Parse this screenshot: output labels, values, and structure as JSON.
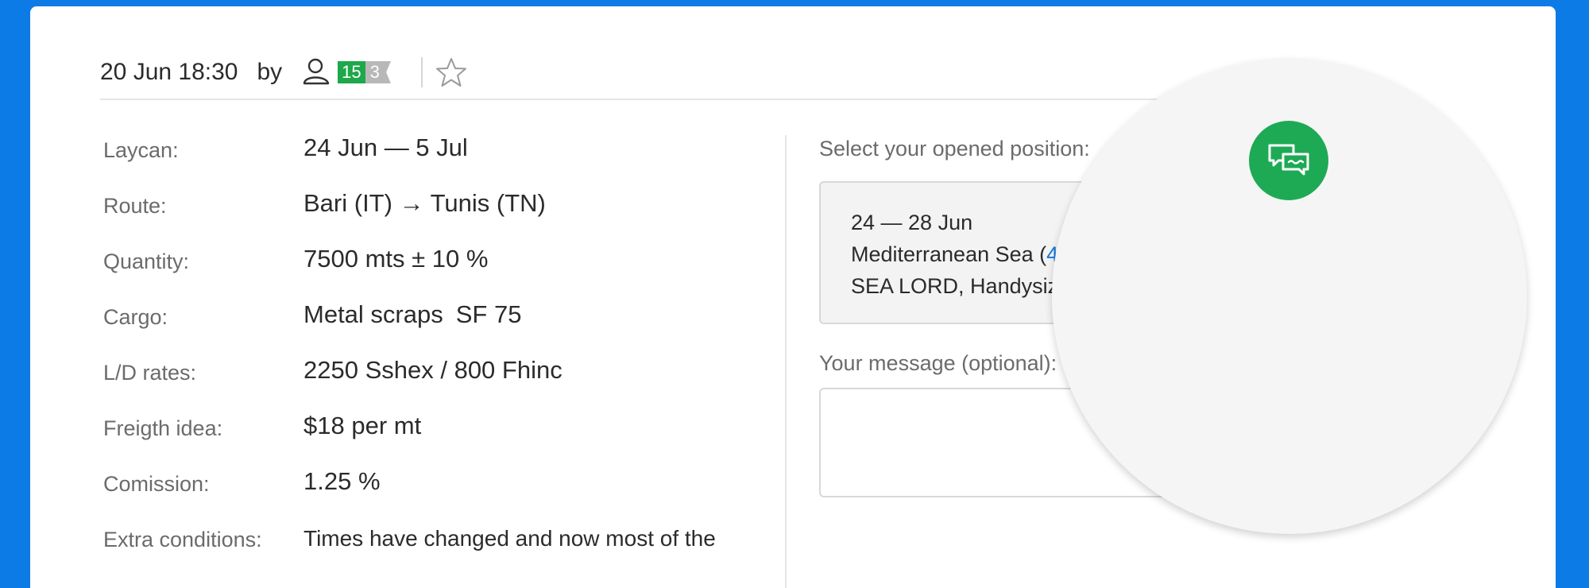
{
  "header": {
    "date": "20 Jun 18:30",
    "by_label": "by",
    "user_icon": "user-icon",
    "rating_positive": "15",
    "rating_neutral": "3",
    "favorite_icon": "star-outline-icon"
  },
  "details": [
    {
      "label": "Laycan:",
      "value": "24 Jun — 5 Jul"
    },
    {
      "label": "Route:",
      "value": "Bari (IT) → Tunis (TN)"
    },
    {
      "label": "Quantity:",
      "value": "7500 mts ± 10 %"
    },
    {
      "label": "Cargo:",
      "value": "Metal scraps",
      "extra": "SF 75"
    },
    {
      "label": "L/D rates:",
      "value": "2250 Sshex / 800 Fhinc"
    },
    {
      "label": "Freigth idea:",
      "value": "$18 per mt"
    },
    {
      "label": "Comission:",
      "value": "1.25 %"
    },
    {
      "label": "Extra conditions:",
      "value": "Times have changed and now most of the"
    }
  ],
  "offer": {
    "position_label": "Select your opened position:",
    "position": {
      "dates": "24 — 28 Jun",
      "region": "Mediterranean Sea (",
      "region_link": "4",
      "vessel": "SEA LORD, Handysiz"
    },
    "message_label": "Your message (optional):",
    "message_value": ""
  },
  "chat": {
    "icon": "chat-icon"
  },
  "colors": {
    "background": "#0d7be6",
    "accent_green": "#1eaa55",
    "rating_green": "#1ea84a",
    "rating_grey": "#b8b8b8",
    "link": "#1577d8"
  }
}
